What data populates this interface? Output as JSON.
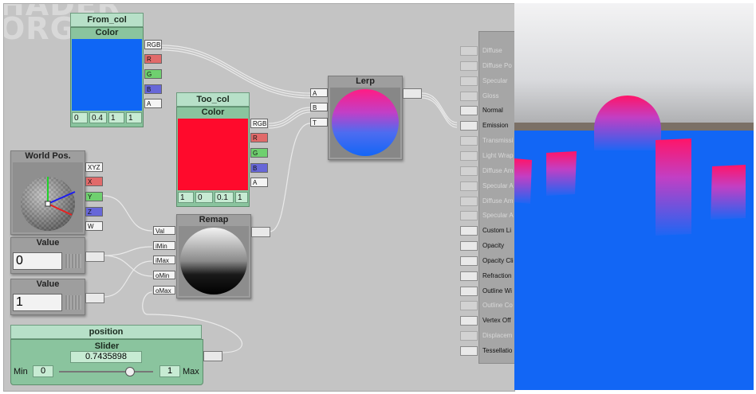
{
  "watermark": {
    "line1": "HADER",
    "line2": "ORGE"
  },
  "colors": {
    "blue_swatch": "#0f66f5",
    "red_swatch": "#ff0a2c",
    "node_green": "#b7e0c8"
  },
  "nodes": {
    "from_col": {
      "name": "From_col",
      "header": "Color",
      "values": [
        "0",
        "0.4",
        "1",
        "1"
      ]
    },
    "too_col": {
      "name": "Too_col",
      "header": "Color",
      "values": [
        "1",
        "0",
        "0.1",
        "1"
      ]
    },
    "lerp": {
      "title": "Lerp",
      "inputs": [
        "A",
        "B",
        "T"
      ]
    },
    "remap": {
      "title": "Remap",
      "inputs": [
        "Val",
        "iMin",
        "iMax",
        "oMin",
        "oMax"
      ]
    },
    "world_pos": {
      "title": "World Pos.",
      "outputs": [
        "XYZ",
        "X",
        "Y",
        "Z",
        "W"
      ]
    },
    "value1": {
      "title": "Value",
      "value": "0"
    },
    "value2": {
      "title": "Value",
      "value": "1"
    },
    "position": {
      "name": "position",
      "header": "Slider",
      "value": "0.7435898",
      "min_label": "Min",
      "min": "0",
      "max": "1",
      "max_label": "Max",
      "fraction": 0.7435898
    }
  },
  "color_outputs": [
    "RGB",
    "R",
    "G",
    "B",
    "A"
  ],
  "main_inputs": [
    {
      "label": "Diffuse",
      "enabled": false
    },
    {
      "label": "Diffuse Po",
      "enabled": false
    },
    {
      "label": "Specular",
      "enabled": false
    },
    {
      "label": "Gloss",
      "enabled": false
    },
    {
      "label": "Normal",
      "enabled": true
    },
    {
      "label": "Emission",
      "enabled": true
    },
    {
      "label": "Transmissi",
      "enabled": false
    },
    {
      "label": "Light Wrap",
      "enabled": false
    },
    {
      "label": "Diffuse Am",
      "enabled": false
    },
    {
      "label": "Specular A",
      "enabled": false
    },
    {
      "label": "Diffuse Am",
      "enabled": false
    },
    {
      "label": "Specular A",
      "enabled": false
    },
    {
      "label": "Custom Li",
      "enabled": true
    },
    {
      "label": "Opacity",
      "enabled": true
    },
    {
      "label": "Opacity Cli",
      "enabled": true
    },
    {
      "label": "Refraction",
      "enabled": true
    },
    {
      "label": "Outline Wi",
      "enabled": true
    },
    {
      "label": "Outline Co",
      "enabled": false
    },
    {
      "label": "Vertex Off",
      "enabled": true
    },
    {
      "label": "Displacem",
      "enabled": false
    },
    {
      "label": "Tessellatio",
      "enabled": true
    }
  ]
}
